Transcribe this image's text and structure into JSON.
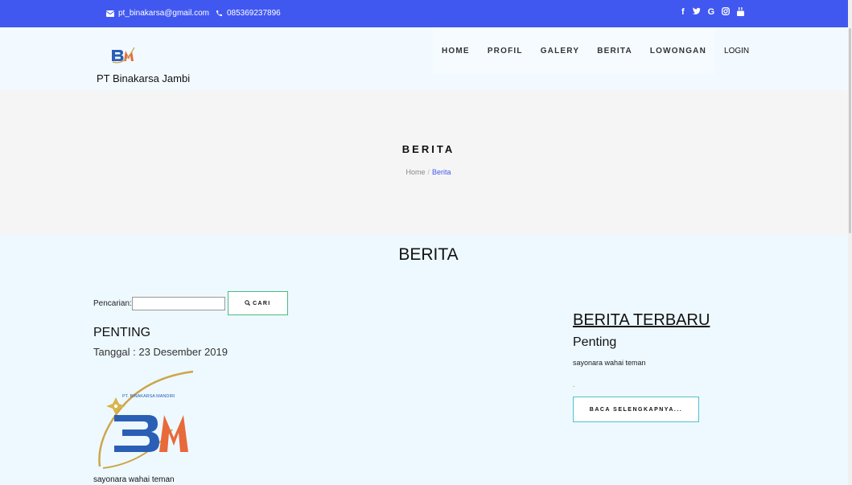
{
  "topbar": {
    "email": "pt_binakarsa@gmail.com",
    "phone": "085369237896",
    "social": [
      "f",
      "♦",
      "G",
      "◎",
      "■"
    ],
    "bar_color": "#4158f0"
  },
  "header": {
    "brand": "PT Binakarsa Jambi"
  },
  "nav": {
    "items": [
      "HOME",
      "PROFIL",
      "GALERY",
      "BERITA",
      "LOWONGAN",
      "LOGIN"
    ]
  },
  "hero": {
    "title": "BERITA",
    "breadcrumb": {
      "home": "Home",
      "separator": "/",
      "current": "Berita"
    }
  },
  "section": {
    "title": "BERITA"
  },
  "search": {
    "label": "Pencarian:",
    "value": "",
    "button": "CARI"
  },
  "post": {
    "title": "PENTING",
    "date": "Tanggal : 23 Desember 2019",
    "image_caption": "PT. BINAKARSA MANDIRI",
    "excerpt": "sayonara wahai teman"
  },
  "latest": {
    "title": "BERITA TERBARU",
    "item_title": "Penting",
    "item_text": "sayonara wahai teman",
    "dot": ".",
    "button": "BACA SELENGKAPNYA..."
  },
  "colors": {
    "accent": "#4158f0",
    "search_border": "#4cbb7f",
    "read_border": "#4fc3cf",
    "content_bg": "#eef9ff"
  }
}
